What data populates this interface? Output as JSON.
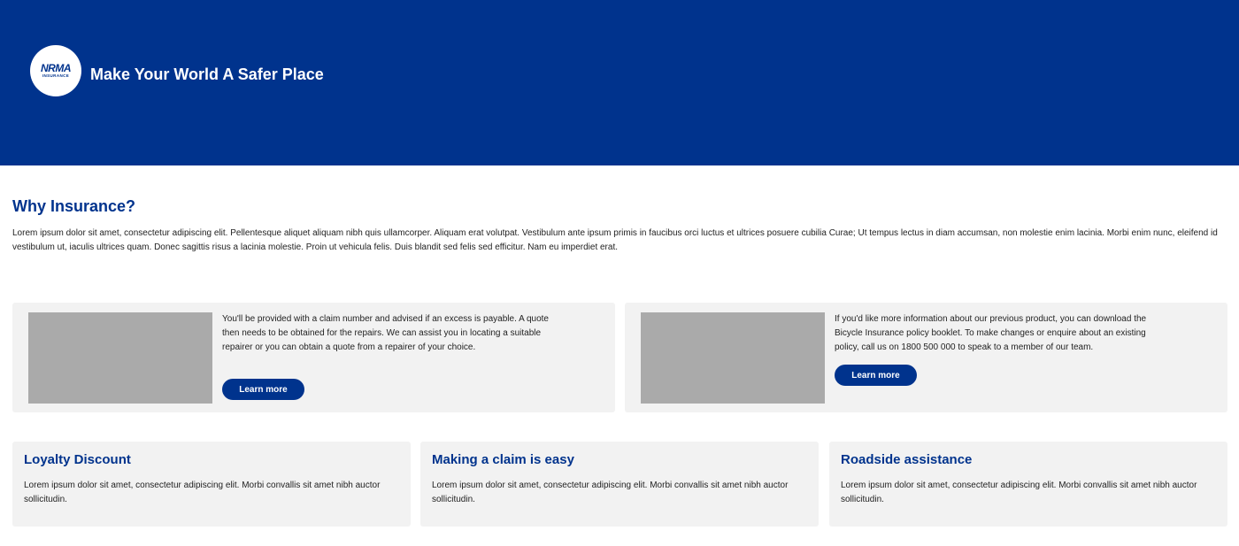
{
  "header": {
    "logo_mark": "NRMA",
    "logo_sub": "INSURANCE",
    "title": "Make Your World A Safer Place",
    "bg_color": "#00338d"
  },
  "intro": {
    "heading": "Why Insurance?",
    "body": "Lorem ipsum dolor sit amet, consectetur adipiscing elit. Pellentesque aliquet aliquam nibh quis ullamcorper. Aliquam erat volutpat. Vestibulum ante ipsum primis in faucibus orci luctus et ultrices posuere cubilia Curae; Ut tempus lectus in diam accumsan, non molestie enim lacinia. Morbi enim nunc, eleifend id vestibulum ut, iaculis ultrices quam. Donec sagittis risus a lacinia molestie. Proin ut vehicula felis. Duis blandit sed felis sed efficitur. Nam eu imperdiet erat."
  },
  "features": [
    {
      "text": "You'll be provided with a claim number and advised if an excess is payable. A quote then needs to be obtained for the repairs. We can assist you in locating a suitable repairer or you can obtain a quote from a repairer of your choice.",
      "button_label": "Learn more"
    },
    {
      "text": "If you'd like more information about our previous product, you can download the Bicycle Insurance policy booklet. To make changes or enquire about an existing policy, call us on 1800 500 000 to speak to a member of our team.",
      "button_label": "Learn more"
    }
  ],
  "info_cards": [
    {
      "title": "Loyalty Discount",
      "text": "Lorem ipsum dolor sit amet, consectetur adipiscing elit. Morbi convallis sit amet nibh auctor sollicitudin."
    },
    {
      "title": "Making a claim is easy",
      "text": "Lorem ipsum dolor sit amet, consectetur adipiscing elit. Morbi convallis sit amet nibh auctor sollicitudin."
    },
    {
      "title": "Roadside assistance",
      "text": "Lorem ipsum dolor sit amet, consectetur adipiscing elit. Morbi convallis sit amet nibh auctor sollicitudin."
    }
  ],
  "colors": {
    "brand": "#00338d",
    "card_bg": "#f2f2f2",
    "image_placeholder": "#aaaaaa"
  }
}
